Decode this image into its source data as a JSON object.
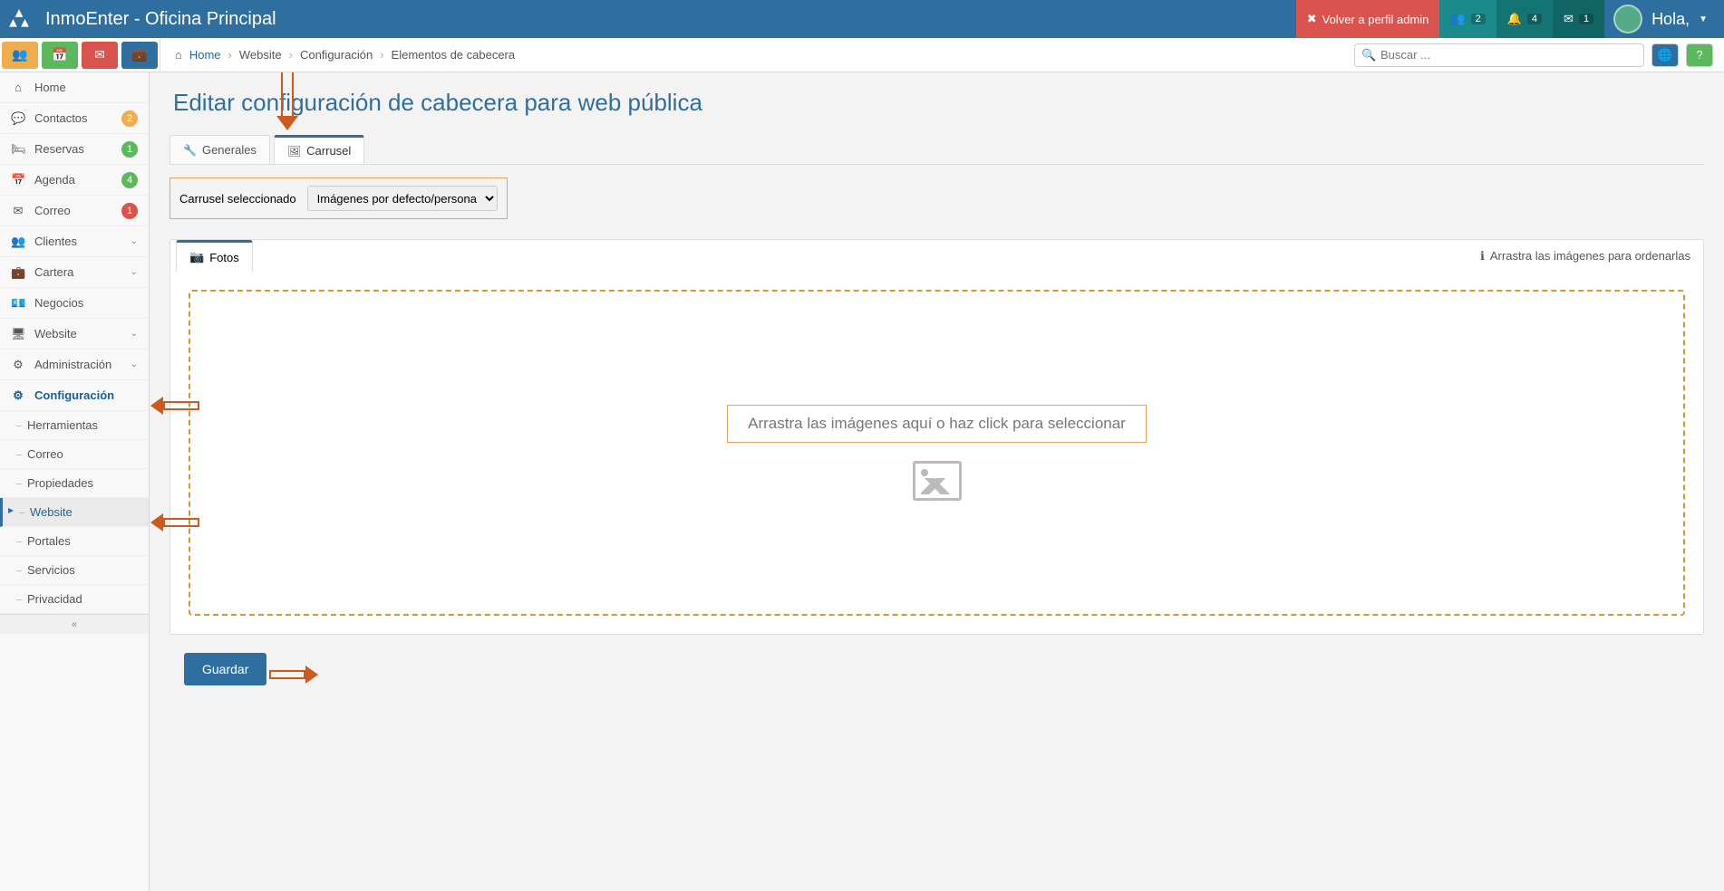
{
  "brand": "InmoEnter - Oficina Principal",
  "top_actions": {
    "back_admin": "Volver a perfil admin",
    "users_badge": "2",
    "notif_badge": "4",
    "mail_badge": "1",
    "greeting": "Hola,"
  },
  "search": {
    "placeholder": "Buscar ..."
  },
  "breadcrumb": {
    "home": "Home",
    "c1": "Website",
    "c2": "Configuración",
    "c3": "Elementos de cabecera"
  },
  "side": {
    "home": "Home",
    "contactos": "Contactos",
    "contactos_b": "2",
    "reservas": "Reservas",
    "reservas_b": "1",
    "agenda": "Agenda",
    "agenda_b": "4",
    "correo": "Correo",
    "correo_b": "1",
    "clientes": "Clientes",
    "cartera": "Cartera",
    "negocios": "Negocios",
    "website": "Website",
    "admin": "Administración",
    "config": "Configuración",
    "sub": {
      "herramientas": "Herramientas",
      "correo": "Correo",
      "propiedades": "Propiedades",
      "website": "Website",
      "portales": "Portales",
      "servicios": "Servicios",
      "privacidad": "Privacidad"
    }
  },
  "page": {
    "title": "Editar configuración de cabecera para web pública",
    "tab_generales": "Generales",
    "tab_carrusel": "Carrusel",
    "selector_label": "Carrusel seleccionado",
    "selector_value": "Imágenes por defecto/personalizadas",
    "fotos_tab": "Fotos",
    "hint": "Arrastra las imágenes para ordenarlas",
    "dropzone": "Arrastra las imágenes aquí o haz click para seleccionar",
    "save": "Guardar"
  }
}
